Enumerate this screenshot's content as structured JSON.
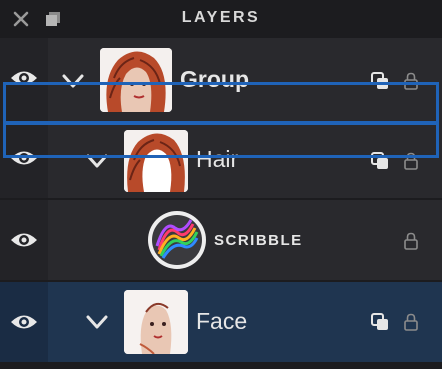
{
  "header": {
    "title": "LAYERS"
  },
  "layers": [
    {
      "name": "Group"
    },
    {
      "name": "Hair"
    },
    {
      "name": "SCRIBBLE"
    },
    {
      "name": "Face"
    }
  ],
  "colors": {
    "selection_outline": "#1f63b8",
    "selected_row": "#1f3550",
    "panel_bg": "#29292d"
  }
}
